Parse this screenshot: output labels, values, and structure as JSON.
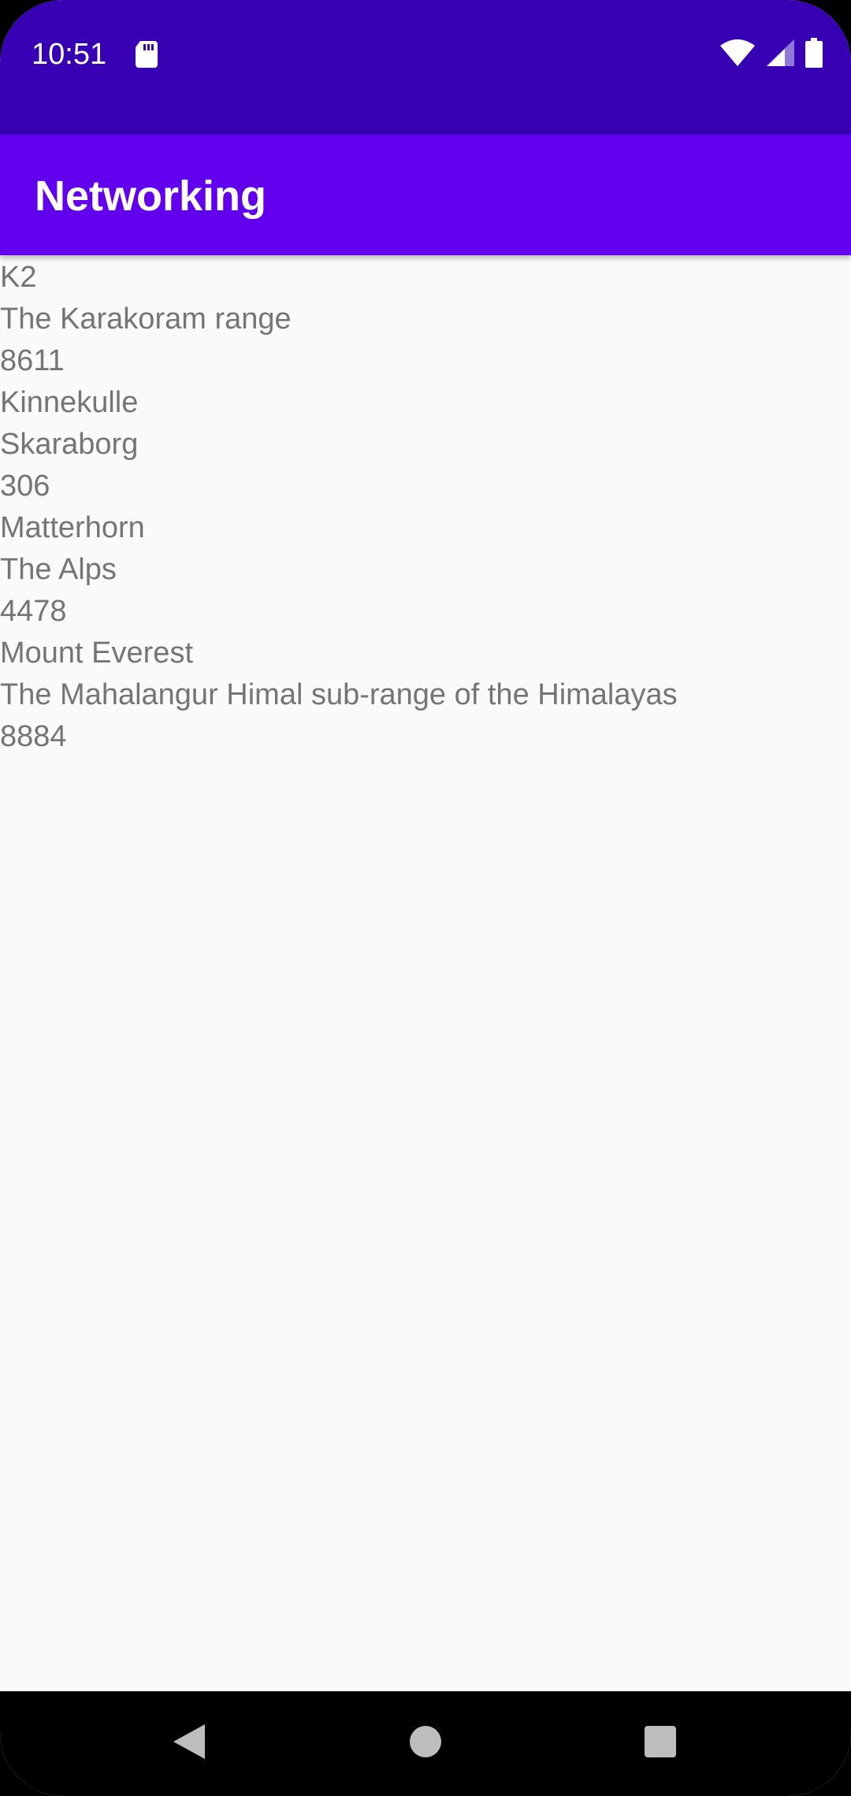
{
  "status_bar": {
    "time": "10:51",
    "icons": [
      "sd-card-icon",
      "wifi-icon",
      "signal-icon",
      "battery-icon"
    ]
  },
  "app_bar": {
    "title": "Networking"
  },
  "content": {
    "lines": [
      "K2",
      "The Karakoram range",
      "8611",
      "Kinnekulle",
      "Skaraborg",
      "306",
      "Matterhorn",
      "The Alps",
      "4478",
      "Mount Everest",
      "The Mahalangur Himal sub-range of the Himalayas",
      "8884"
    ]
  },
  "nav_bar": {
    "buttons": [
      "back-icon",
      "home-icon",
      "recents-icon"
    ]
  },
  "colors": {
    "status_bar": "#3700b3",
    "app_bar": "#6200ee",
    "background": "#fafafa",
    "text": "#757575"
  }
}
